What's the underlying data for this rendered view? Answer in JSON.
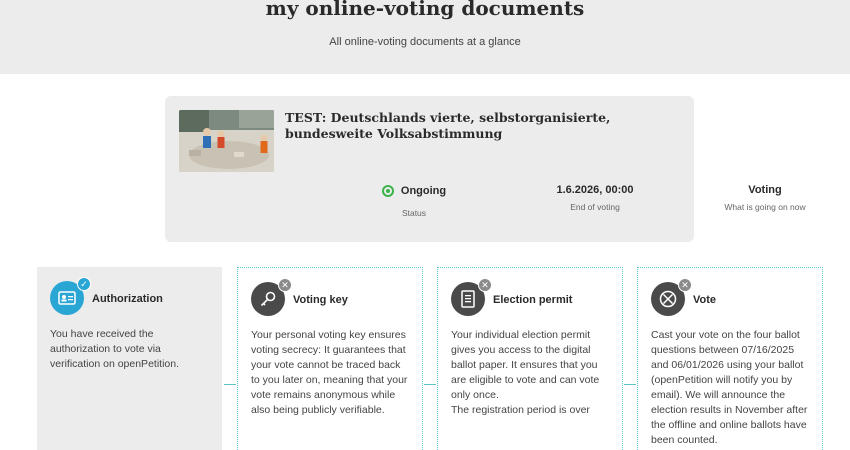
{
  "header": {
    "title": "my online-voting documents",
    "subtitle": "All online-voting documents at a glance"
  },
  "vote": {
    "title": "TEST: Deutschlands vierte, selbstorganisierte, bundesweite Volksabstimmung",
    "status_value": "Ongoing",
    "status_label": "Status",
    "end_value": "1.6.2026, 00:00",
    "end_label": "End of voting",
    "phase_value": "Voting",
    "phase_label": "What is going on now"
  },
  "steps": [
    {
      "title": "Authorization",
      "text": "You have received the authorization to vote via verification on openPetition.",
      "state": "done"
    },
    {
      "title": "Voting key",
      "text": "Your personal voting key ensures voting secrecy: It guarantees that your vote cannot be traced back to you later on, meaning that your vote remains anonymous while also being publicly verifiable.",
      "state": "pending"
    },
    {
      "title": "Election permit",
      "text": "Your individual election permit gives you access to the digital ballot paper. It ensures that you are eligible to vote and can vote only once.\nThe registration period is over",
      "state": "pending"
    },
    {
      "title": "Vote",
      "text": "Cast your vote on the four ballot questions between 07/16/2025 and 06/01/2026 using your ballot (openPetition will notify you by email). We will announce the election results in November after the offline and online ballots have been counted.",
      "state": "pending"
    }
  ],
  "colors": {
    "accent": "#2aa6d4",
    "status_ok": "#3bb44a",
    "dotted_border": "#5fc3cc"
  }
}
